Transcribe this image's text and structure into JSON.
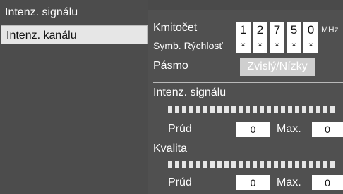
{
  "menu": {
    "items": [
      {
        "label": "Intenz. signálu"
      },
      {
        "label": "Intenz. kanálu"
      }
    ]
  },
  "panel": {
    "frequency_label": "Kmitočet",
    "frequency_digits": [
      "1",
      "2",
      "7",
      "5",
      "0"
    ],
    "frequency_unit": "MHz",
    "symbol_rate_label": "Symb. Rýchlosť",
    "symbol_rate_digits": [
      "*",
      "*",
      "*",
      "*",
      "*"
    ],
    "band_label": "Pásmo",
    "band_value": "Zvislý/Nízky",
    "signal_strength": {
      "title": "Intenz. signálu",
      "current_label": "Prúd",
      "current_value": "0",
      "max_label": "Max.",
      "max_value": "0"
    },
    "quality": {
      "title": "Kvalita",
      "current_label": "Prúd",
      "current_value": "0",
      "max_label": "Max.",
      "max_value": "0"
    }
  }
}
